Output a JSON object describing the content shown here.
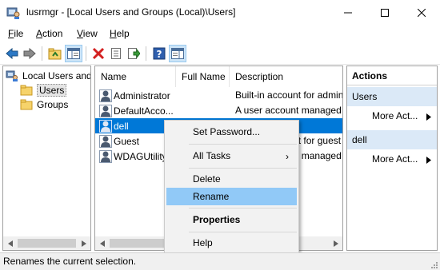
{
  "window": {
    "title": "lusrmgr - [Local Users and Groups (Local)\\Users]",
    "minimize_glyph": "—",
    "maximize_glyph": "☐",
    "close_glyph": "✕"
  },
  "menubar": {
    "file": {
      "accel": "F",
      "rest": "ile"
    },
    "action": {
      "accel": "A",
      "rest": "ction"
    },
    "view": {
      "accel": "V",
      "rest": "iew"
    },
    "help": {
      "accel": "H",
      "rest": "elp"
    }
  },
  "toolbar": {
    "icons": [
      "back-arrow-icon",
      "forward-arrow-icon",
      "up-folder-icon",
      "show-hide-tree-icon",
      "delete-icon",
      "properties-icon",
      "export-list-icon",
      "help-icon",
      "show-hide-action-pane-icon"
    ]
  },
  "tree": {
    "root": "Local Users and Groups (Local)",
    "users": "Users",
    "groups": "Groups"
  },
  "list": {
    "columns": [
      "Name",
      "Full Name",
      "Description"
    ],
    "rows": [
      {
        "name": "Administrator",
        "full_name": "",
        "description": "Built-in account for administering..."
      },
      {
        "name": "DefaultAcco...",
        "full_name": "",
        "description": "A user account managed by the system."
      },
      {
        "name": "dell",
        "full_name": "",
        "description": ""
      },
      {
        "name": "Guest",
        "full_name": "",
        "description": "Built-in account for guest access"
      },
      {
        "name": "WDAGUtility...",
        "full_name": "",
        "description": "A user account managed and used by..."
      }
    ],
    "selected_row": "dell"
  },
  "actions": {
    "header": "Actions",
    "section_users": "Users",
    "more_actions_1": "More Act...",
    "section_dell": "dell",
    "more_actions_2": "More Act..."
  },
  "context_menu": {
    "items": [
      "Set Password...",
      "All Tasks",
      "Delete",
      "Rename",
      "Properties",
      "Help"
    ],
    "hovered": "Rename",
    "default_item": "Properties",
    "submenu_arrow": "›"
  },
  "statusbar": {
    "text": "Renames the current selection."
  },
  "colors": {
    "selection": "#0078d7",
    "menu_hover": "#91c9f7",
    "action_section": "#dbe9f7"
  }
}
